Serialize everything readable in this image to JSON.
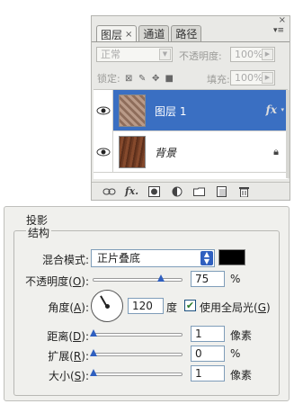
{
  "layers_panel": {
    "close_glyph": "×",
    "tabs": [
      {
        "label": "图层",
        "close": "×",
        "active": true
      },
      {
        "label": "通道",
        "active": false
      },
      {
        "label": "路径",
        "active": false
      }
    ],
    "menu_glyph": "▾≡",
    "blend_mode": "正常",
    "opacity_label": "不透明度:",
    "opacity_value": "100%",
    "lock_label": "锁定:",
    "fill_label": "填充:",
    "fill_value": "100%",
    "layers": [
      {
        "name": "图层 1",
        "selected": true,
        "has_fx": true,
        "fx_label": "fx"
      },
      {
        "name": "背景",
        "selected": false,
        "locked": true
      }
    ],
    "footer_fx": "fx."
  },
  "drop_shadow": {
    "title": "投影",
    "structure_title": "结构",
    "blend_mode_label": "混合模式:",
    "blend_mode_value": "正片叠底",
    "shadow_color": "#000000",
    "opacity_label": "不透明度(",
    "opacity_key": "O",
    "label_close": "):",
    "opacity_value": "75",
    "opacity_slider": 0.75,
    "percent_unit": "%",
    "angle_label": "角度(",
    "angle_key": "A",
    "angle_value": "120",
    "angle_degrees": 120,
    "angle_unit": "度",
    "global_light_checked": true,
    "global_light_label": "使用全局光(",
    "global_light_key": "G",
    "global_light_close": ")",
    "distance_label": "距离(",
    "distance_key": "D",
    "distance_value": "1",
    "distance_unit": "像素",
    "spread_label": "扩展(",
    "spread_key": "R",
    "spread_value": "0",
    "size_label": "大小(",
    "size_key": "S",
    "size_value": "1",
    "size_unit": "像素"
  },
  "colors": {
    "selection": "#3a6fc2",
    "accent": "#2f5fbf"
  }
}
